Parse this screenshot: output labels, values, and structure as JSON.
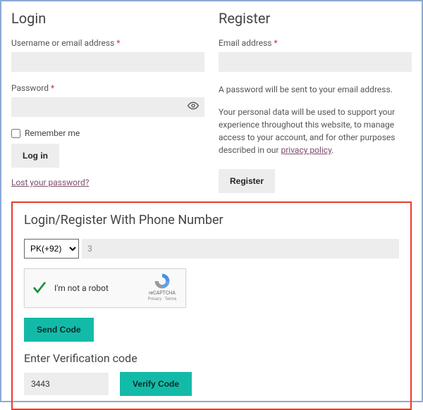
{
  "login": {
    "heading": "Login",
    "username_label": "Username or email address",
    "password_label": "Password",
    "required": "*",
    "remember": "Remember me",
    "button": "Log in",
    "lost_link": "Lost your password?"
  },
  "register": {
    "heading": "Register",
    "email_label": "Email address",
    "required": "*",
    "pw_note": "A password will be sent to your email address.",
    "privacy_text": "Your personal data will be used to support your experience throughout this website, to manage access to your account, and for other purposes described in our ",
    "privacy_link": "privacy policy",
    "privacy_tail": ".",
    "button": "Register"
  },
  "phone": {
    "heading": "Login/Register With Phone Number",
    "dial_code": "PK(+92)",
    "number": "3",
    "recaptcha_label": "I'm not a robot",
    "recaptcha_brand": "reCAPTCHA",
    "recaptcha_sub": "Privacy · Terms",
    "send_btn": "Send Code",
    "verify_heading": "Enter Verification code",
    "code": "3443",
    "verify_btn": "Verify Code"
  }
}
